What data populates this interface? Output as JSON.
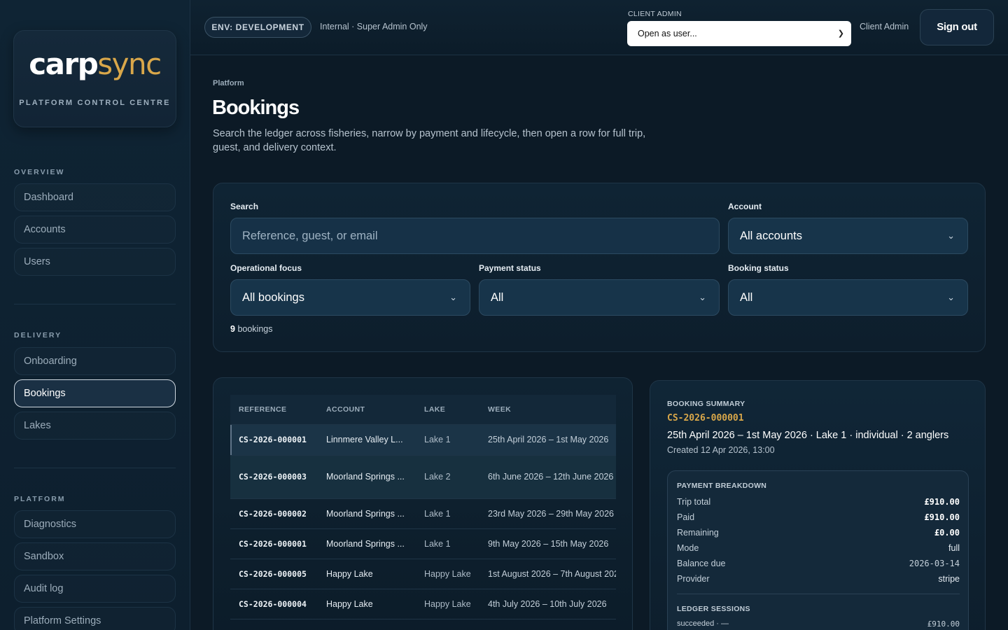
{
  "brand": {
    "logo_a": "carp",
    "logo_b": "sync",
    "subtitle": "PLATFORM CONTROL CENTRE"
  },
  "sidebar": {
    "sections": [
      {
        "title": "OVERVIEW",
        "items": [
          "Dashboard",
          "Accounts",
          "Users"
        ]
      },
      {
        "title": "DELIVERY",
        "items": [
          "Onboarding",
          "Bookings",
          "Lakes"
        ]
      },
      {
        "title": "PLATFORM",
        "items": [
          "Diagnostics",
          "Sandbox",
          "Audit log",
          "Platform Settings"
        ]
      }
    ],
    "active": "Bookings"
  },
  "topbar": {
    "env": "ENV: DEVELOPMENT",
    "env_note": "Internal · Super Admin Only",
    "client_admin_label": "CLIENT ADMIN",
    "client_admin_select": "Open as user...",
    "client_admin_name": "Client Admin",
    "sign_out": "Sign out"
  },
  "page": {
    "breadcrumb": "Platform",
    "title": "Bookings",
    "description": "Search the ledger across fisheries, narrow by payment and lifecycle, then open a row for full trip, guest, and delivery context."
  },
  "filters": {
    "search_label": "Search",
    "search_placeholder": "Reference, guest, or email",
    "account_label": "Account",
    "account_value": "All accounts",
    "focus_label": "Operational focus",
    "focus_value": "All bookings",
    "payment_label": "Payment status",
    "payment_value": "All",
    "booking_label": "Booking status",
    "booking_value": "All",
    "count_number": "9",
    "count_text": "bookings"
  },
  "table": {
    "headers": [
      "REFERENCE",
      "ACCOUNT",
      "LAKE",
      "WEEK"
    ],
    "rows": [
      {
        "ref": "CS-2026-000001",
        "account": "Linnmere Valley L...",
        "lake": "Lake 1",
        "week": "25th April 2026 – 1st May 2026"
      },
      {
        "ref": "CS-2026-000003",
        "account": "Moorland Springs ...",
        "lake": "Lake 2",
        "week": "6th June 2026 – 12th June 2026"
      },
      {
        "ref": "CS-2026-000002",
        "account": "Moorland Springs ...",
        "lake": "Lake 1",
        "week": "23rd May 2026 – 29th May 2026"
      },
      {
        "ref": "CS-2026-000001",
        "account": "Moorland Springs ...",
        "lake": "Lake 1",
        "week": "9th May 2026 – 15th May 2026"
      },
      {
        "ref": "CS-2026-000005",
        "account": "Happy Lake",
        "lake": "Happy Lake",
        "week": "1st August 2026 – 7th August 2026"
      },
      {
        "ref": "CS-2026-000004",
        "account": "Happy Lake",
        "lake": "Happy Lake",
        "week": "4th July 2026 – 10th July 2026"
      }
    ]
  },
  "summary": {
    "label": "BOOKING SUMMARY",
    "ref": "CS-2026-000001",
    "trip": "25th April 2026 – 1st May 2026 · Lake 1 · individual · 2 anglers",
    "created": "Created 12 Apr 2026, 13:00",
    "payment_title": "PAYMENT BREAKDOWN",
    "payment_rows": [
      {
        "k": "Trip total",
        "v": "£910.00"
      },
      {
        "k": "Paid",
        "v": "£910.00"
      },
      {
        "k": "Remaining",
        "v": "£0.00"
      },
      {
        "k": "Mode",
        "v": "full"
      },
      {
        "k": "Balance due",
        "v": "2026-03-14"
      },
      {
        "k": "Provider",
        "v": "stripe"
      }
    ],
    "ledger_title": "LEDGER SESSIONS",
    "ledger_row": {
      "k": "succeeded · —",
      "v": "£910.00"
    }
  }
}
